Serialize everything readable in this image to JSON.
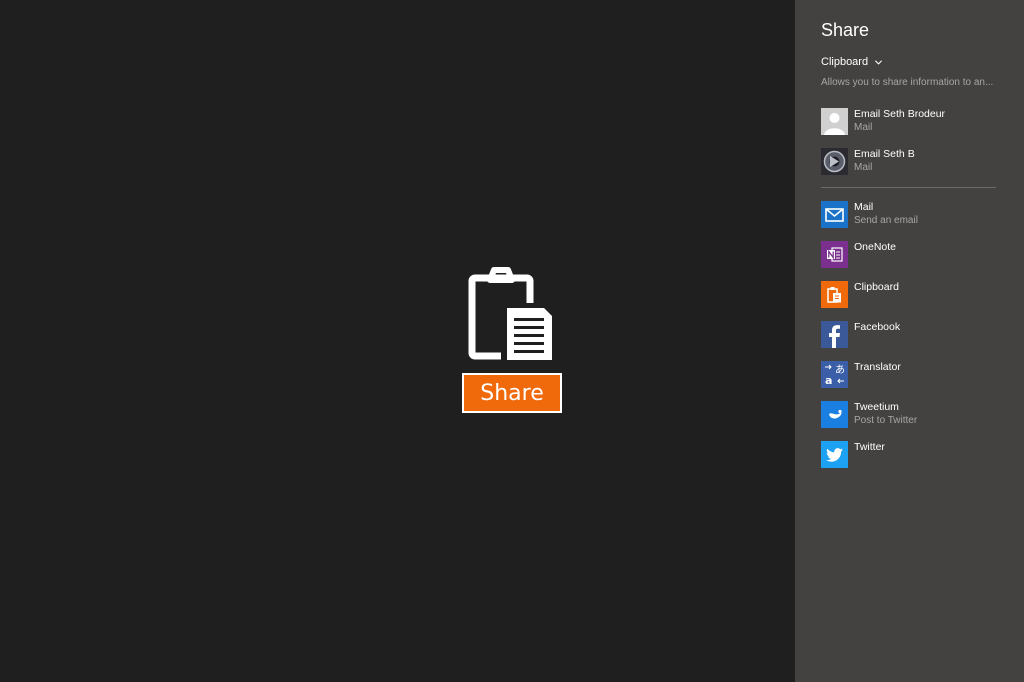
{
  "app": {
    "share_button_label": "Share"
  },
  "charm": {
    "title": "Share",
    "source_label": "Clipboard",
    "source_description": "Allows you to share information to an...",
    "recent": [
      {
        "name": "Email Seth Brodeur",
        "sub": "Mail",
        "icon": "person-avatar-icon"
      },
      {
        "name": "Email Seth B",
        "sub": "Mail",
        "icon": "photo-avatar-icon"
      }
    ],
    "apps": [
      {
        "name": "Mail",
        "sub": "Send an email",
        "icon": "mail-icon",
        "color": "#1a73c8"
      },
      {
        "name": "OneNote",
        "sub": "",
        "icon": "onenote-icon",
        "color": "#7b2f8e"
      },
      {
        "name": "Clipboard",
        "sub": "",
        "icon": "clipboard-icon",
        "color": "#f06a0c"
      },
      {
        "name": "Facebook",
        "sub": "",
        "icon": "facebook-icon",
        "color": "#3b5998"
      },
      {
        "name": "Translator",
        "sub": "",
        "icon": "translator-icon",
        "color": "#3a5fa8"
      },
      {
        "name": "Tweetium",
        "sub": "Post to Twitter",
        "icon": "tweetium-icon",
        "color": "#1a7fe0"
      },
      {
        "name": "Twitter",
        "sub": "",
        "icon": "twitter-icon",
        "color": "#1da1f2"
      }
    ]
  },
  "colors": {
    "app_background": "#1f1f1f",
    "charm_background": "#444240",
    "accent": "#f06a0c"
  }
}
